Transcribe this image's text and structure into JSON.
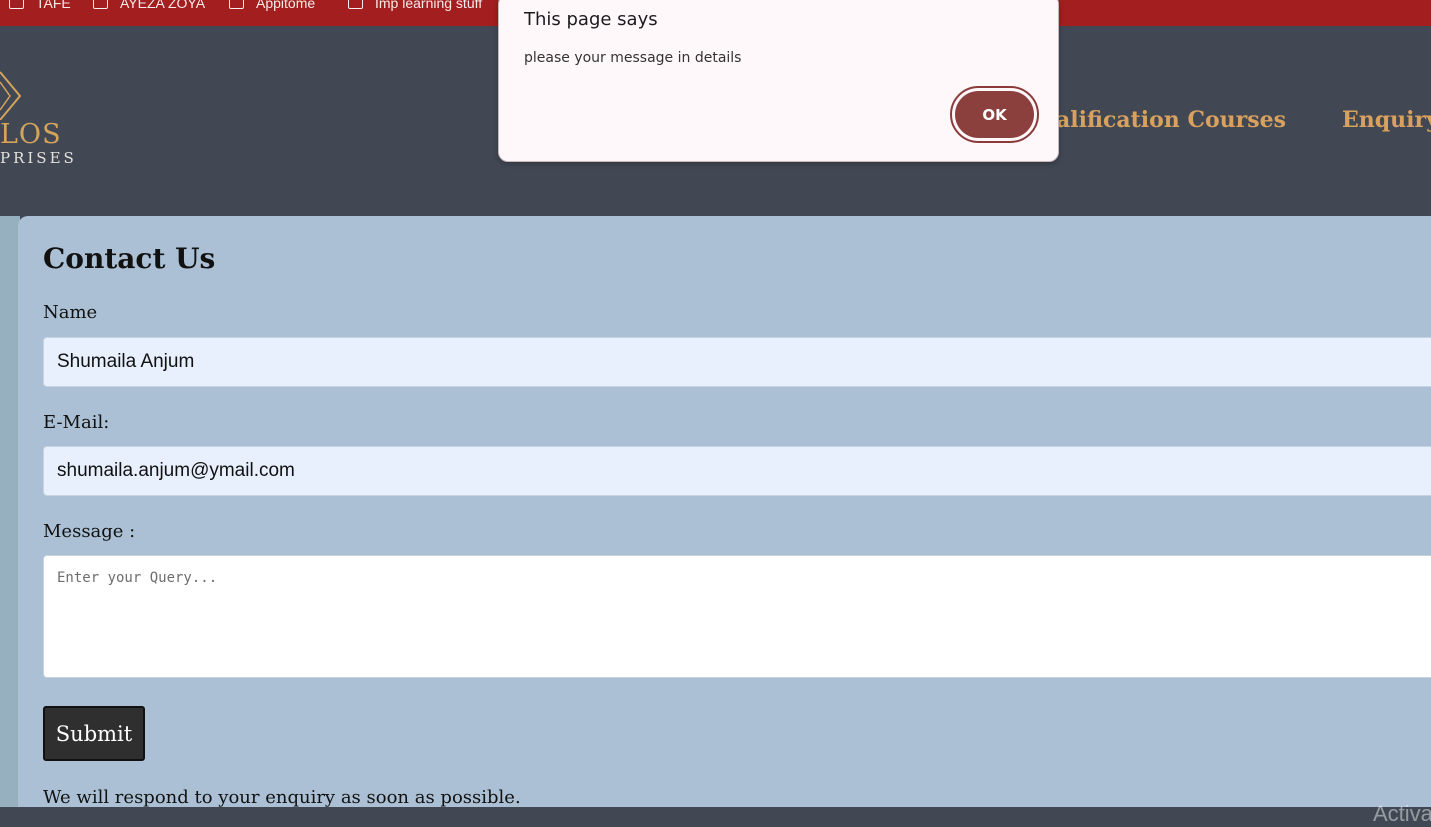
{
  "bookmarks": [
    {
      "label": "TAFE"
    },
    {
      "label": "AYEZA ZOYA"
    },
    {
      "label": "Appitome"
    },
    {
      "label": "Imp learning stuff"
    }
  ],
  "header": {
    "logo_line1": "LOS",
    "logo_line2": "PRISES",
    "nav": [
      {
        "label": "ualification Courses"
      },
      {
        "label": "Enquiry"
      }
    ]
  },
  "contact": {
    "title": "Contact Us",
    "name_label": "Name",
    "name_value": "Shumaila Anjum",
    "email_label": "E-Mail:",
    "email_value": "shumaila.anjum@ymail.com",
    "message_label": "Message :",
    "message_placeholder": "Enter your Query...",
    "submit_label": "Submit",
    "respond_text": "We will respond to your enquiry as soon as possible."
  },
  "dialog": {
    "title": "This page says",
    "message": "please your message in details",
    "ok_label": "OK"
  },
  "watermark": "Activa",
  "colors": {
    "bookmarks_bar": "#a31f1f",
    "header_bg": "#414854",
    "nav_text": "#d9a15e",
    "card_bg": "#abc0d4",
    "field_bg": "#e8f0fe",
    "submit_bg": "#2f2f2f",
    "ok_button": "#8b403d"
  }
}
